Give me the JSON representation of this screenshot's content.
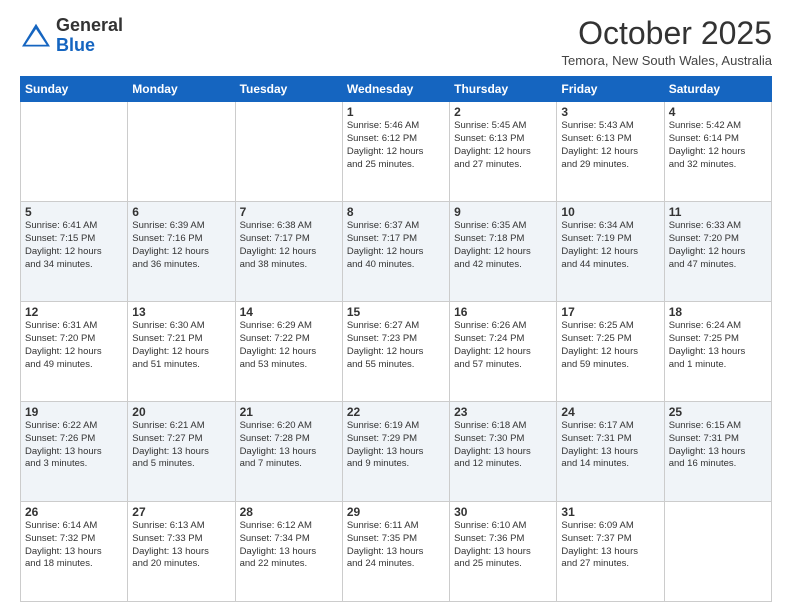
{
  "header": {
    "logo_general": "General",
    "logo_blue": "Blue",
    "month_title": "October 2025",
    "location": "Temora, New South Wales, Australia"
  },
  "days_of_week": [
    "Sunday",
    "Monday",
    "Tuesday",
    "Wednesday",
    "Thursday",
    "Friday",
    "Saturday"
  ],
  "weeks": [
    [
      {
        "day": "",
        "info": ""
      },
      {
        "day": "",
        "info": ""
      },
      {
        "day": "",
        "info": ""
      },
      {
        "day": "1",
        "info": "Sunrise: 5:46 AM\nSunset: 6:12 PM\nDaylight: 12 hours\nand 25 minutes."
      },
      {
        "day": "2",
        "info": "Sunrise: 5:45 AM\nSunset: 6:13 PM\nDaylight: 12 hours\nand 27 minutes."
      },
      {
        "day": "3",
        "info": "Sunrise: 5:43 AM\nSunset: 6:13 PM\nDaylight: 12 hours\nand 29 minutes."
      },
      {
        "day": "4",
        "info": "Sunrise: 5:42 AM\nSunset: 6:14 PM\nDaylight: 12 hours\nand 32 minutes."
      }
    ],
    [
      {
        "day": "5",
        "info": "Sunrise: 6:41 AM\nSunset: 7:15 PM\nDaylight: 12 hours\nand 34 minutes."
      },
      {
        "day": "6",
        "info": "Sunrise: 6:39 AM\nSunset: 7:16 PM\nDaylight: 12 hours\nand 36 minutes."
      },
      {
        "day": "7",
        "info": "Sunrise: 6:38 AM\nSunset: 7:17 PM\nDaylight: 12 hours\nand 38 minutes."
      },
      {
        "day": "8",
        "info": "Sunrise: 6:37 AM\nSunset: 7:17 PM\nDaylight: 12 hours\nand 40 minutes."
      },
      {
        "day": "9",
        "info": "Sunrise: 6:35 AM\nSunset: 7:18 PM\nDaylight: 12 hours\nand 42 minutes."
      },
      {
        "day": "10",
        "info": "Sunrise: 6:34 AM\nSunset: 7:19 PM\nDaylight: 12 hours\nand 44 minutes."
      },
      {
        "day": "11",
        "info": "Sunrise: 6:33 AM\nSunset: 7:20 PM\nDaylight: 12 hours\nand 47 minutes."
      }
    ],
    [
      {
        "day": "12",
        "info": "Sunrise: 6:31 AM\nSunset: 7:20 PM\nDaylight: 12 hours\nand 49 minutes."
      },
      {
        "day": "13",
        "info": "Sunrise: 6:30 AM\nSunset: 7:21 PM\nDaylight: 12 hours\nand 51 minutes."
      },
      {
        "day": "14",
        "info": "Sunrise: 6:29 AM\nSunset: 7:22 PM\nDaylight: 12 hours\nand 53 minutes."
      },
      {
        "day": "15",
        "info": "Sunrise: 6:27 AM\nSunset: 7:23 PM\nDaylight: 12 hours\nand 55 minutes."
      },
      {
        "day": "16",
        "info": "Sunrise: 6:26 AM\nSunset: 7:24 PM\nDaylight: 12 hours\nand 57 minutes."
      },
      {
        "day": "17",
        "info": "Sunrise: 6:25 AM\nSunset: 7:25 PM\nDaylight: 12 hours\nand 59 minutes."
      },
      {
        "day": "18",
        "info": "Sunrise: 6:24 AM\nSunset: 7:25 PM\nDaylight: 13 hours\nand 1 minute."
      }
    ],
    [
      {
        "day": "19",
        "info": "Sunrise: 6:22 AM\nSunset: 7:26 PM\nDaylight: 13 hours\nand 3 minutes."
      },
      {
        "day": "20",
        "info": "Sunrise: 6:21 AM\nSunset: 7:27 PM\nDaylight: 13 hours\nand 5 minutes."
      },
      {
        "day": "21",
        "info": "Sunrise: 6:20 AM\nSunset: 7:28 PM\nDaylight: 13 hours\nand 7 minutes."
      },
      {
        "day": "22",
        "info": "Sunrise: 6:19 AM\nSunset: 7:29 PM\nDaylight: 13 hours\nand 9 minutes."
      },
      {
        "day": "23",
        "info": "Sunrise: 6:18 AM\nSunset: 7:30 PM\nDaylight: 13 hours\nand 12 minutes."
      },
      {
        "day": "24",
        "info": "Sunrise: 6:17 AM\nSunset: 7:31 PM\nDaylight: 13 hours\nand 14 minutes."
      },
      {
        "day": "25",
        "info": "Sunrise: 6:15 AM\nSunset: 7:31 PM\nDaylight: 13 hours\nand 16 minutes."
      }
    ],
    [
      {
        "day": "26",
        "info": "Sunrise: 6:14 AM\nSunset: 7:32 PM\nDaylight: 13 hours\nand 18 minutes."
      },
      {
        "day": "27",
        "info": "Sunrise: 6:13 AM\nSunset: 7:33 PM\nDaylight: 13 hours\nand 20 minutes."
      },
      {
        "day": "28",
        "info": "Sunrise: 6:12 AM\nSunset: 7:34 PM\nDaylight: 13 hours\nand 22 minutes."
      },
      {
        "day": "29",
        "info": "Sunrise: 6:11 AM\nSunset: 7:35 PM\nDaylight: 13 hours\nand 24 minutes."
      },
      {
        "day": "30",
        "info": "Sunrise: 6:10 AM\nSunset: 7:36 PM\nDaylight: 13 hours\nand 25 minutes."
      },
      {
        "day": "31",
        "info": "Sunrise: 6:09 AM\nSunset: 7:37 PM\nDaylight: 13 hours\nand 27 minutes."
      },
      {
        "day": "",
        "info": ""
      }
    ]
  ]
}
